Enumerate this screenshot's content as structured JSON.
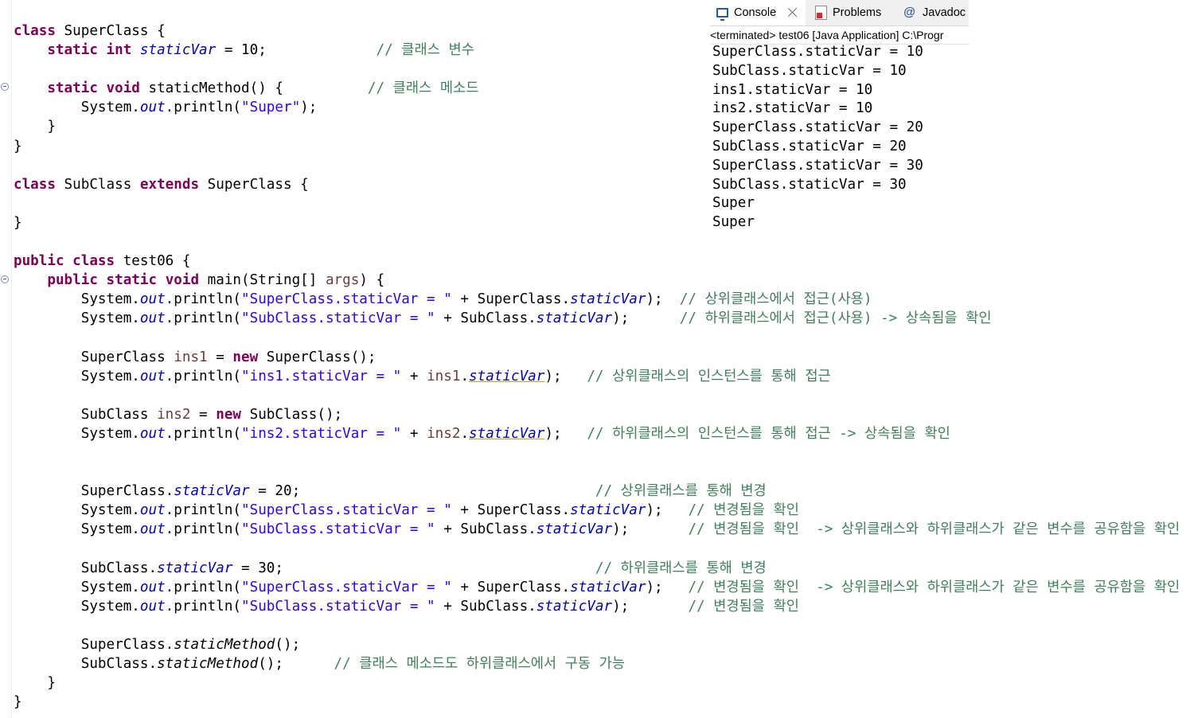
{
  "editor": {
    "code_lines": [
      [
        {
          "t": "class",
          "c": "kw"
        },
        {
          "t": " SuperClass {"
        }
      ],
      [
        {
          "t": "    "
        },
        {
          "t": "static",
          "c": "kw"
        },
        {
          "t": " "
        },
        {
          "t": "int",
          "c": "kw"
        },
        {
          "t": " "
        },
        {
          "t": "staticVar",
          "c": "sf"
        },
        {
          "t": " = 10;             "
        },
        {
          "t": "// 클래스 변수",
          "c": "cm"
        }
      ],
      [],
      [
        {
          "t": "    "
        },
        {
          "t": "static",
          "c": "kw"
        },
        {
          "t": " "
        },
        {
          "t": "void",
          "c": "kw"
        },
        {
          "t": " staticMethod() {          "
        },
        {
          "t": "// 클래스 메소드",
          "c": "cm"
        }
      ],
      [
        {
          "t": "        System."
        },
        {
          "t": "out",
          "c": "sf"
        },
        {
          "t": ".println("
        },
        {
          "t": "\"Super\"",
          "c": "st"
        },
        {
          "t": ");"
        }
      ],
      [
        {
          "t": "    }"
        }
      ],
      [
        {
          "t": "}"
        }
      ],
      [],
      [
        {
          "t": "class",
          "c": "kw"
        },
        {
          "t": " SubClass "
        },
        {
          "t": "extends",
          "c": "kw"
        },
        {
          "t": " SuperClass {"
        }
      ],
      [],
      [
        {
          "t": "}"
        }
      ],
      [],
      [
        {
          "t": "public",
          "c": "kw"
        },
        {
          "t": " "
        },
        {
          "t": "class",
          "c": "kw"
        },
        {
          "t": " test06 {"
        }
      ],
      [
        {
          "t": "    "
        },
        {
          "t": "public",
          "c": "kw"
        },
        {
          "t": " "
        },
        {
          "t": "static",
          "c": "kw"
        },
        {
          "t": " "
        },
        {
          "t": "void",
          "c": "kw"
        },
        {
          "t": " main(String[] "
        },
        {
          "t": "args",
          "c": "lv"
        },
        {
          "t": ") {"
        }
      ],
      [
        {
          "t": "        System."
        },
        {
          "t": "out",
          "c": "sf"
        },
        {
          "t": ".println("
        },
        {
          "t": "\"SuperClass.staticVar = \"",
          "c": "st"
        },
        {
          "t": " + SuperClass."
        },
        {
          "t": "staticVar",
          "c": "sf"
        },
        {
          "t": ");  "
        },
        {
          "t": "// 상위클래스에서 접근(사용)",
          "c": "cm"
        }
      ],
      [
        {
          "t": "        System."
        },
        {
          "t": "out",
          "c": "sf"
        },
        {
          "t": ".println("
        },
        {
          "t": "\"SubClass.staticVar = \"",
          "c": "st"
        },
        {
          "t": " + SubClass."
        },
        {
          "t": "staticVar",
          "c": "sf"
        },
        {
          "t": ");      "
        },
        {
          "t": "// 하위클래스에서 접근(사용) -> 상속됨을 확인",
          "c": "cm"
        }
      ],
      [],
      [
        {
          "t": "        SuperClass "
        },
        {
          "t": "ins1",
          "c": "lv"
        },
        {
          "t": " = "
        },
        {
          "t": "new",
          "c": "kw"
        },
        {
          "t": " SuperClass();"
        }
      ],
      [
        {
          "t": "        System."
        },
        {
          "t": "out",
          "c": "sf"
        },
        {
          "t": ".println("
        },
        {
          "t": "\"ins1.staticVar = \"",
          "c": "st"
        },
        {
          "t": " + "
        },
        {
          "t": "ins1",
          "c": "lv"
        },
        {
          "t": "."
        },
        {
          "t": "staticVar",
          "c": "sf ul"
        },
        {
          "t": ");   "
        },
        {
          "t": "// 상위클래스의 인스턴스를 통해 접근",
          "c": "cm"
        }
      ],
      [],
      [
        {
          "t": "        SubClass "
        },
        {
          "t": "ins2",
          "c": "lv"
        },
        {
          "t": " = "
        },
        {
          "t": "new",
          "c": "kw"
        },
        {
          "t": " SubClass();"
        }
      ],
      [
        {
          "t": "        System."
        },
        {
          "t": "out",
          "c": "sf"
        },
        {
          "t": ".println("
        },
        {
          "t": "\"ins2.staticVar = \"",
          "c": "st"
        },
        {
          "t": " + "
        },
        {
          "t": "ins2",
          "c": "lv"
        },
        {
          "t": "."
        },
        {
          "t": "staticVar",
          "c": "sf ul"
        },
        {
          "t": ");   "
        },
        {
          "t": "// 하위클래스의 인스턴스를 통해 접근 -> 상속됨을 확인",
          "c": "cm"
        }
      ],
      [],
      [],
      [
        {
          "t": "        SuperClass."
        },
        {
          "t": "staticVar",
          "c": "sf"
        },
        {
          "t": " = 20;                                   "
        },
        {
          "t": "// 상위클래스를 통해 변경",
          "c": "cm"
        }
      ],
      [
        {
          "t": "        System."
        },
        {
          "t": "out",
          "c": "sf"
        },
        {
          "t": ".println("
        },
        {
          "t": "\"SuperClass.staticVar = \"",
          "c": "st"
        },
        {
          "t": " + SuperClass."
        },
        {
          "t": "staticVar",
          "c": "sf"
        },
        {
          "t": ");   "
        },
        {
          "t": "// 변경됨을 확인",
          "c": "cm"
        }
      ],
      [
        {
          "t": "        System."
        },
        {
          "t": "out",
          "c": "sf"
        },
        {
          "t": ".println("
        },
        {
          "t": "\"SubClass.staticVar = \"",
          "c": "st"
        },
        {
          "t": " + SubClass."
        },
        {
          "t": "staticVar",
          "c": "sf"
        },
        {
          "t": ");       "
        },
        {
          "t": "// 변경됨을 확인  -> 상위클래스와 하위클래스가 같은 변수를 공유함을 확인",
          "c": "cm"
        }
      ],
      [],
      [
        {
          "t": "        SubClass."
        },
        {
          "t": "staticVar",
          "c": "sf"
        },
        {
          "t": " = 30;                                     "
        },
        {
          "t": "// 하위클래스를 통해 변경",
          "c": "cm"
        }
      ],
      [
        {
          "t": "        System."
        },
        {
          "t": "out",
          "c": "sf"
        },
        {
          "t": ".println("
        },
        {
          "t": "\"SuperClass.staticVar = \"",
          "c": "st"
        },
        {
          "t": " + SuperClass."
        },
        {
          "t": "staticVar",
          "c": "sf"
        },
        {
          "t": ");   "
        },
        {
          "t": "// 변경됨을 확인  -> 상위클래스와 하위클래스가 같은 변수를 공유함을 확인",
          "c": "cm"
        }
      ],
      [
        {
          "t": "        System."
        },
        {
          "t": "out",
          "c": "sf"
        },
        {
          "t": ".println("
        },
        {
          "t": "\"SubClass.staticVar = \"",
          "c": "st"
        },
        {
          "t": " + SubClass."
        },
        {
          "t": "staticVar",
          "c": "sf"
        },
        {
          "t": ");       "
        },
        {
          "t": "// 변경됨을 확인",
          "c": "cm"
        }
      ],
      [],
      [
        {
          "t": "        SuperClass."
        },
        {
          "t": "staticMethod",
          "c": "sm"
        },
        {
          "t": "();"
        }
      ],
      [
        {
          "t": "        SubClass."
        },
        {
          "t": "staticMethod",
          "c": "sm"
        },
        {
          "t": "();      "
        },
        {
          "t": "// 클래스 메소드도 하위클래스에서 구동 가능",
          "c": "cm"
        }
      ],
      [
        {
          "t": "    }"
        }
      ],
      [
        {
          "t": "}"
        }
      ]
    ],
    "colors": {
      "keyword": "#7f0055",
      "static_field": "#0000c0",
      "string": "#2a00ff",
      "comment": "#3f7f5f",
      "local_variable": "#6a3e3e"
    }
  },
  "console": {
    "tabs": {
      "console": "Console",
      "problems": "Problems",
      "javadoc": "Javadoc"
    },
    "status": "<terminated> test06 [Java Application] C:\\Progr",
    "output_lines": [
      "SuperClass.staticVar = 10",
      "SubClass.staticVar = 10",
      "ins1.staticVar = 10",
      "ins2.staticVar = 10",
      "SuperClass.staticVar = 20",
      "SubClass.staticVar = 20",
      "SuperClass.staticVar = 30",
      "SubClass.staticVar = 30",
      "Super",
      "Super"
    ]
  }
}
